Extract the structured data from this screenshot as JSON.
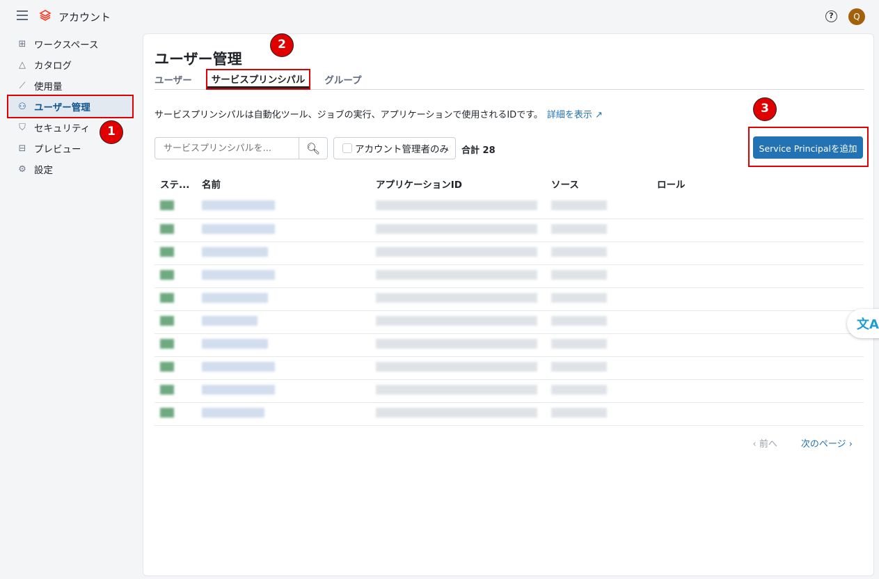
{
  "header": {
    "app_title": "アカウント",
    "avatar_initial": "Q"
  },
  "sidebar": {
    "items": [
      {
        "label": "ワークスペース",
        "icon": "workspace-icon"
      },
      {
        "label": "カタログ",
        "icon": "catalog-icon"
      },
      {
        "label": "使用量",
        "icon": "chart-icon"
      },
      {
        "label": "ユーザー管理",
        "icon": "users-icon",
        "active": true
      },
      {
        "label": "セキュリティ",
        "icon": "shield-icon"
      },
      {
        "label": "プレビュー",
        "icon": "gift-icon"
      },
      {
        "label": "設定",
        "icon": "gear-icon"
      }
    ]
  },
  "annotations": {
    "b1": "1",
    "b2": "2",
    "b3": "3"
  },
  "main": {
    "title": "ユーザー管理",
    "tabs": [
      {
        "label": "ユーザー"
      },
      {
        "label": "サービスプリンシパル",
        "active": true
      },
      {
        "label": "グループ"
      }
    ],
    "description": "サービスプリンシパルは自動化ツール、ジョブの実行、アプリケーションで使用されるIDです。",
    "details_link": "詳細を表示",
    "search_placeholder": "サービスプリンシパルを...",
    "filter_label": "アカウント管理者のみ",
    "total": "合計 28",
    "add_button": "Service Principalを追加",
    "columns": [
      "ステ...",
      "名前",
      "アプリケーションID",
      "ソース",
      "ロール"
    ],
    "row_count_visible": 10,
    "prev": "前へ",
    "next": "次のページ"
  },
  "colors": {
    "accent": "#2272b4",
    "annotation": "#e00000"
  }
}
